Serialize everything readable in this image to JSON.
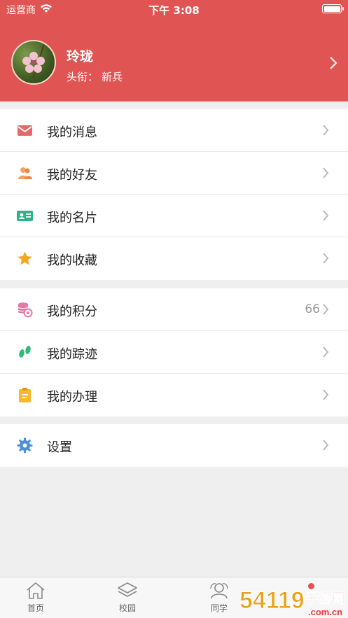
{
  "status_bar": {
    "carrier": "运营商",
    "time": "下午 3:08"
  },
  "profile": {
    "name": "玲珑",
    "title_label": "头衔：",
    "title_value": "新兵"
  },
  "menu_groups": [
    [
      {
        "label": "我的消息",
        "icon": "envelope-icon"
      },
      {
        "label": "我的好友",
        "icon": "friends-icon"
      },
      {
        "label": "我的名片",
        "icon": "card-icon"
      },
      {
        "label": "我的收藏",
        "icon": "star-icon"
      }
    ],
    [
      {
        "label": "我的积分",
        "icon": "points-icon",
        "value": "66"
      },
      {
        "label": "我的踪迹",
        "icon": "footprint-icon"
      },
      {
        "label": "我的办理",
        "icon": "clipboard-icon"
      }
    ],
    [
      {
        "label": "设置",
        "icon": "gear-icon"
      }
    ]
  ],
  "tabbar": {
    "items": [
      {
        "label": "首页",
        "icon": "home-icon"
      },
      {
        "label": "校园",
        "icon": "layers-icon"
      },
      {
        "label": "同学",
        "icon": "classmates-icon"
      }
    ]
  },
  "colors": {
    "accent": "#e05553",
    "background": "#efefef"
  },
  "watermark": {
    "text": "54119手游网",
    "sub": ".com.cn"
  }
}
